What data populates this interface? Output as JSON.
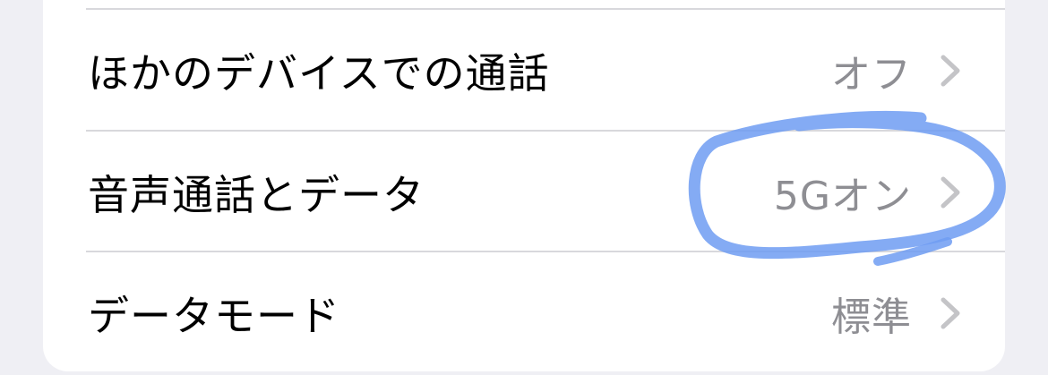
{
  "settings": {
    "rows": [
      {
        "label": "ほかのデバイスでの通話",
        "value": "オフ",
        "chevron_icon": "chevron-right-icon"
      },
      {
        "label": "音声通話とデータ",
        "value": "5Gオン",
        "chevron_icon": "chevron-right-icon"
      },
      {
        "label": "データモード",
        "value": "標準",
        "chevron_icon": "chevron-right-icon"
      }
    ]
  },
  "annotation": {
    "type": "hand-drawn highlight",
    "color": "#6f9cf2"
  }
}
